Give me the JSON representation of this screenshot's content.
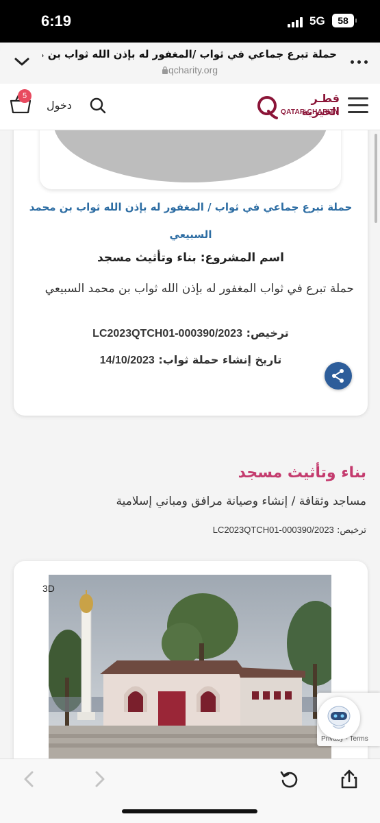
{
  "status_bar": {
    "time": "6:19",
    "network": "5G",
    "battery": "58"
  },
  "browser": {
    "page_title": "حملة تبرع جماعي في ثواب /المغفور له بإذن الله ثواب بن م...",
    "domain": "qcharity.org"
  },
  "header": {
    "cart_count": "5",
    "login_label": "دخول",
    "logo_arabic": "قطـر الخيرية",
    "logo_english": "QATAR CHARITY"
  },
  "campaign": {
    "title": "حملة تبرع جماعي في ثواب / المغفور له بإذن الله ثواب بن محمد السبيعي",
    "project_name_label": "اسم المشروع:",
    "project_name": "بناء وتأثيث مسجد",
    "description": "حملة تبرع في ثواب المغفور له بإذن الله ثواب بن محمد السبيعي",
    "license_label": "ترخيص:",
    "license_value": "LC2023QTCH01-000390/2023",
    "date_label": "تاريخ إنشاء حملة ثواب:",
    "date_value": "14/10/2023"
  },
  "project_section": {
    "title": "بناء وتأثيث مسجد",
    "category": "مساجد وثقافة / إنشاء وصيانة مرافق ومباني إسلامية",
    "license_label": "ترخيص:",
    "license_value": "LC2023QTCH01-000390/2023",
    "badge": "3D"
  },
  "recaptcha": {
    "text": "Privacy - Terms"
  },
  "colors": {
    "brand_maroon": "#8b1538",
    "link_blue": "#2d6da3",
    "section_pink": "#c43b6e",
    "share_blue": "#2d5d9a",
    "badge_red": "#e84a5f"
  },
  "icons": {
    "back": "chevron-left-icon",
    "forward": "chevron-right-icon",
    "reload": "reload-icon",
    "share": "share-icon",
    "cart": "cart-icon",
    "search": "search-icon",
    "menu": "hamburger-icon",
    "more": "more-icon"
  }
}
